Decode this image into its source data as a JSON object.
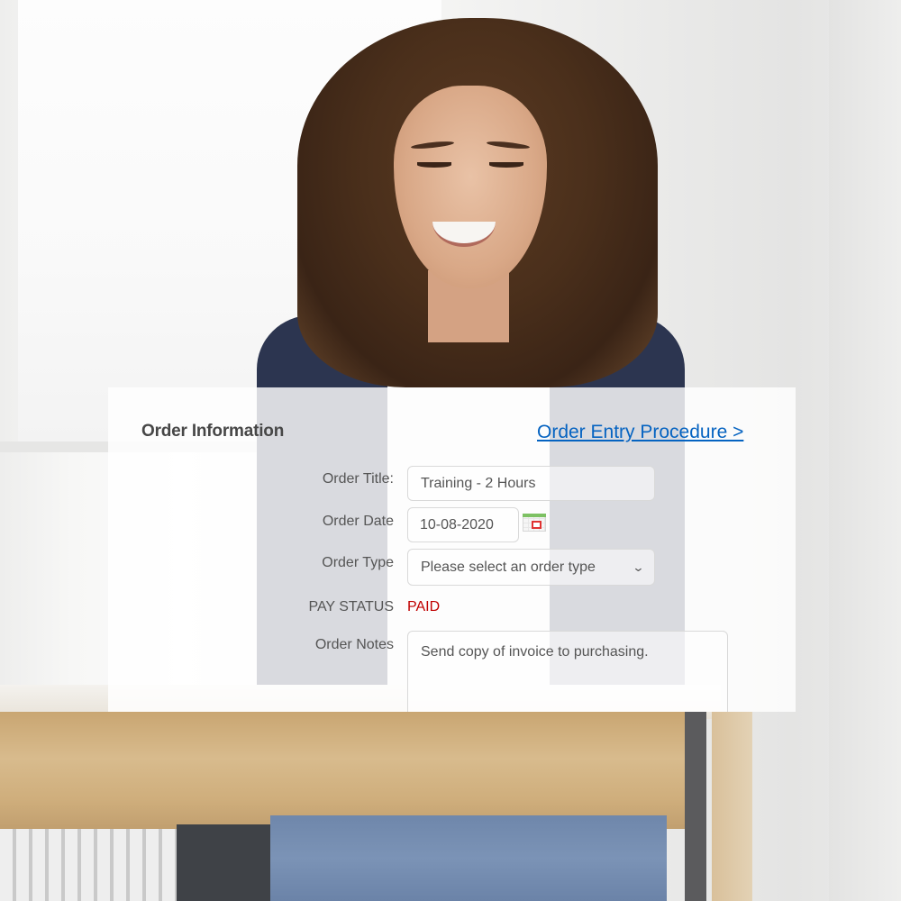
{
  "panel": {
    "title": "Order Information",
    "procedure_link": "Order Entry Procedure >"
  },
  "form": {
    "order_title": {
      "label": "Order Title:",
      "value": "Training - 2 Hours"
    },
    "order_date": {
      "label": "Order Date",
      "value": "10-08-2020",
      "icon": "calendar-icon"
    },
    "order_type": {
      "label": "Order Type",
      "selected": "Please select an order type",
      "icon": "chevron-down-icon"
    },
    "pay_status": {
      "label": "PAY STATUS",
      "value": "PAID"
    },
    "order_notes": {
      "label": "Order Notes",
      "value": "Send copy of invoice to purchasing."
    }
  },
  "colors": {
    "link": "#0563c1",
    "paid": "#c00000",
    "label": "#555555",
    "title": "#474747"
  }
}
